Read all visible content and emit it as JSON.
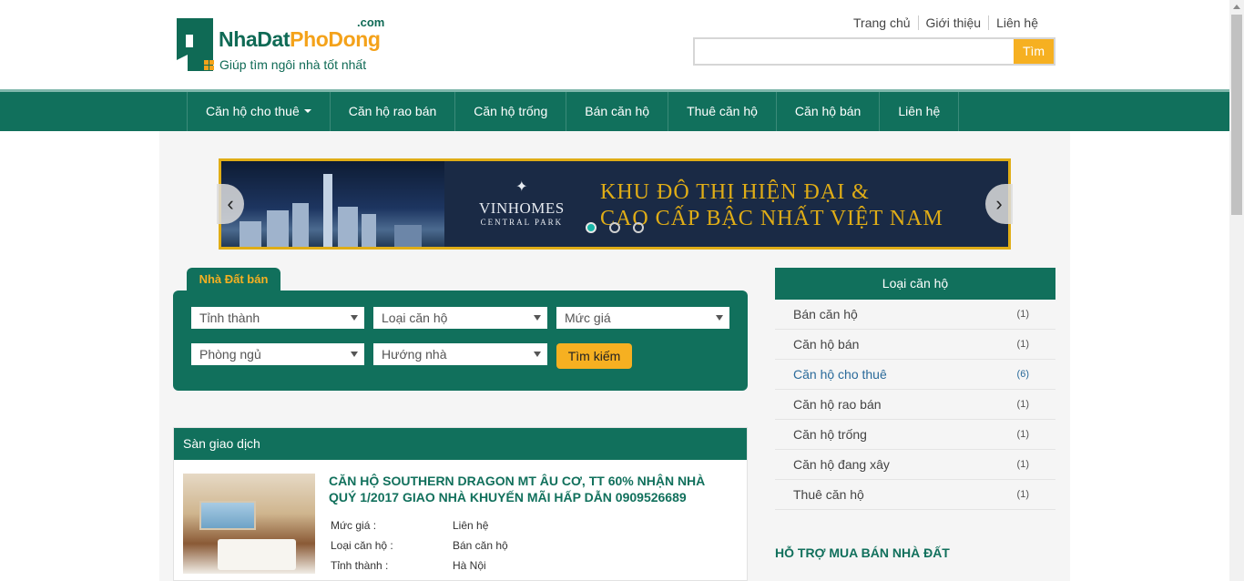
{
  "logo": {
    "com": ".com",
    "name_part1": "NhaDat",
    "name_part2": "PhoDong",
    "tagline": "Giúp tìm ngôi nhà tốt nhất"
  },
  "toplinks": [
    "Trang chủ",
    "Giới thiệu",
    "Liên hệ"
  ],
  "search": {
    "value": "",
    "button": "Tìm"
  },
  "nav": [
    {
      "label": "Căn hộ cho thuê",
      "dropdown": true
    },
    {
      "label": "Căn hộ rao bán"
    },
    {
      "label": "Căn hộ trống"
    },
    {
      "label": "Bán căn hộ"
    },
    {
      "label": "Thuê căn hộ"
    },
    {
      "label": "Căn hộ bán"
    },
    {
      "label": "Liên hệ"
    }
  ],
  "banner": {
    "brand": "VINHOMES",
    "brand_sub": "CENTRAL PARK",
    "line1": "KHU ĐÔ THỊ HIỆN ĐẠI &",
    "line2": "CAO CẤP BẬC NHẤT VIỆT NAM",
    "slides": 3,
    "active_slide": 1
  },
  "search_panel": {
    "tab": "Nhà Đất bán",
    "selects": [
      "Tỉnh thành",
      "Loại căn hộ",
      "Mức giá",
      "Phòng ngủ",
      "Hướng nhà"
    ],
    "button": "Tìm kiếm"
  },
  "listing": {
    "header": "Sàn giao dịch",
    "title": "CĂN HỘ SOUTHERN DRAGON MT ÂU CƠ, TT 60% NHẬN NHÀ QUÝ 1/2017 GIAO NHÀ KHUYẾN MÃI HẤP DẪN 0909526689",
    "rows": [
      {
        "label": "Mức giá :",
        "value": "Liên hệ"
      },
      {
        "label": "Loại căn hộ :",
        "value": "Bán căn hộ"
      },
      {
        "label": "Tỉnh thành :",
        "value": "Hà Nội"
      }
    ]
  },
  "sidebar": {
    "header": "Loại căn hộ",
    "items": [
      {
        "label": "Bán căn hộ",
        "count": "(1)"
      },
      {
        "label": "Căn hộ bán",
        "count": "(1)"
      },
      {
        "label": "Căn hộ cho thuê",
        "count": "(6)"
      },
      {
        "label": "Căn hộ rao bán",
        "count": "(1)"
      },
      {
        "label": "Căn hộ trống",
        "count": "(1)"
      },
      {
        "label": "Căn hộ đang xây",
        "count": "(1)"
      },
      {
        "label": "Thuê căn hộ",
        "count": "(1)"
      }
    ],
    "active_index": 2,
    "support_title": "HỖ TRỢ MUA BÁN NHÀ ĐẤT"
  },
  "colors": {
    "brand": "#11705c",
    "accent": "#f6b021",
    "banner_gold": "#e0ad16"
  }
}
